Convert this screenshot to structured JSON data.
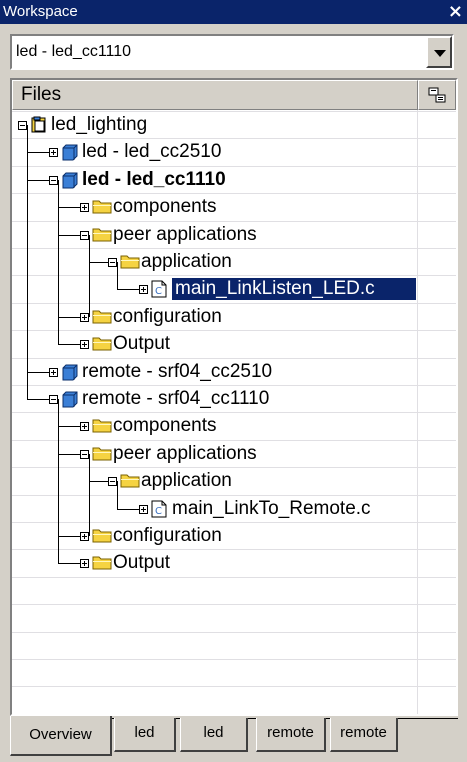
{
  "window": {
    "title": "Workspace",
    "close_label": "×"
  },
  "config": {
    "selected": "led - led_cc1110"
  },
  "panel": {
    "header_label": "Files",
    "header_icon": "settings-icon"
  },
  "tree": [
    {
      "label": "led_lighting",
      "icon": "workspace",
      "bold": false
    },
    {
      "label": "led - led_cc2510",
      "icon": "project",
      "bold": false
    },
    {
      "label": "led - led_cc1110",
      "icon": "project",
      "bold": true
    },
    {
      "label": "components",
      "icon": "folder",
      "bold": false
    },
    {
      "label": "peer applications",
      "icon": "folder",
      "bold": false
    },
    {
      "label": "application",
      "icon": "folder",
      "bold": false
    },
    {
      "label": "main_LinkListen_LED.c",
      "icon": "c-file",
      "bold": false,
      "selected": true
    },
    {
      "label": "configuration",
      "icon": "folder",
      "bold": false
    },
    {
      "label": "Output",
      "icon": "folder",
      "bold": false
    },
    {
      "label": "remote - srf04_cc2510",
      "icon": "project",
      "bold": false
    },
    {
      "label": "remote - srf04_cc1110",
      "icon": "project",
      "bold": false
    },
    {
      "label": "components",
      "icon": "folder",
      "bold": false
    },
    {
      "label": "peer applications",
      "icon": "folder",
      "bold": false
    },
    {
      "label": "application",
      "icon": "folder",
      "bold": false
    },
    {
      "label": "main_LinkTo_Remote.c",
      "icon": "c-file",
      "bold": false
    },
    {
      "label": "configuration",
      "icon": "folder",
      "bold": false
    },
    {
      "label": "Output",
      "icon": "folder",
      "bold": false
    }
  ],
  "tabs": [
    {
      "label": "Overview",
      "active": true
    },
    {
      "label": "led",
      "active": false
    },
    {
      "label": "led",
      "active": false
    },
    {
      "label": "remote",
      "active": false
    },
    {
      "label": "remote",
      "active": false
    }
  ],
  "colors": {
    "selection": "#0a246a",
    "title_bar": "#0a246a",
    "folder": "#f5d342",
    "project": "#3b7fd6"
  }
}
